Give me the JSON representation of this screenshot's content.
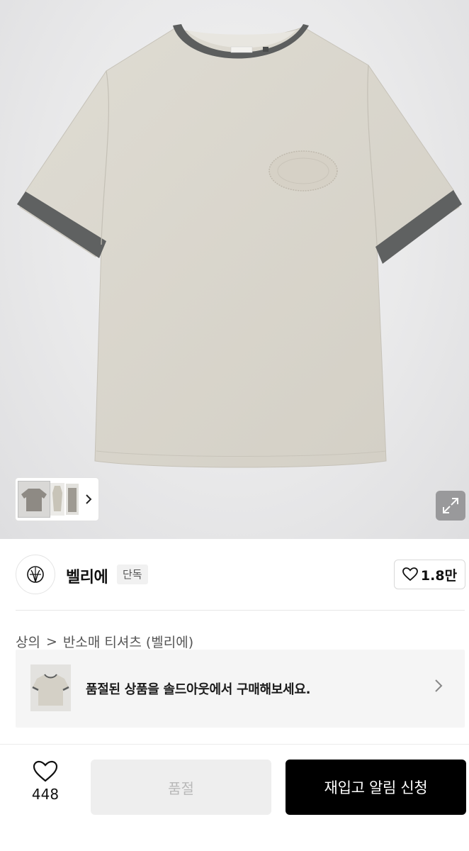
{
  "gallery": {
    "main_image_icon": "tshirt-product-photo",
    "thumbnails": [
      "thumb-front",
      "thumb-model",
      "thumb-side"
    ],
    "next_icon": "chevron-right-icon",
    "expand_icon": "expand-icon"
  },
  "brand": {
    "name": "벨리에",
    "badge": "단독",
    "likes": "1.8만"
  },
  "breadcrumb": {
    "items": [
      "상의",
      "반소매 티셔츠 (벨리에)"
    ],
    "separator": ">"
  },
  "soldout_banner": {
    "text": "품절된 상품을 솔드아웃에서 구매해보세요."
  },
  "bottom_bar": {
    "wish_count": "448",
    "soldout_label": "품절",
    "restock_label": "재입고 알림 신청"
  },
  "colors": {
    "shirt_body": "#d8d4ca",
    "trim": "#5c5e5e",
    "primary_button": "#000000",
    "disabled_button": "#eeeeee"
  }
}
